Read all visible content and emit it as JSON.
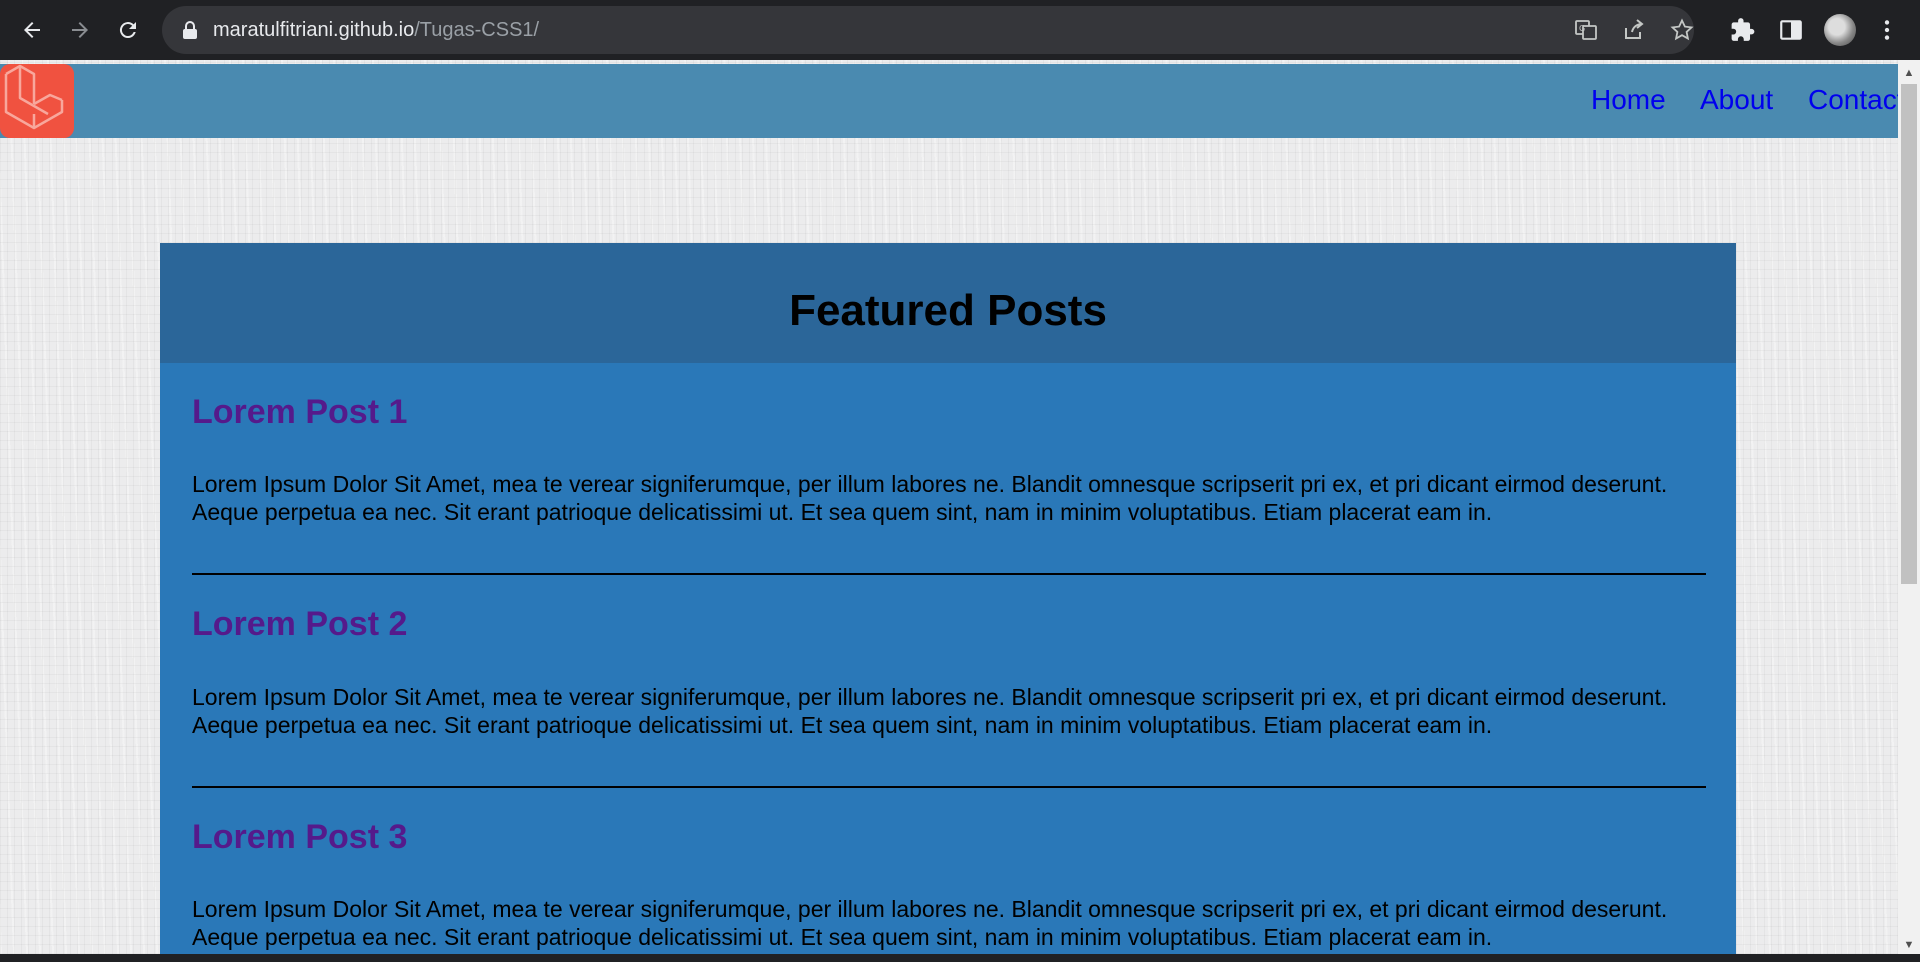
{
  "browser": {
    "url_host": "maratulfitriani.github.io",
    "url_path": "/Tugas-CSS1/",
    "icons": [
      "back-arrow-icon",
      "forward-arrow-icon",
      "reload-icon",
      "lock-icon",
      "translate-icon",
      "share-icon",
      "star-icon",
      "extensions-icon",
      "side-panel-icon",
      "profile-avatar",
      "kebab-menu-icon"
    ]
  },
  "header": {
    "logo": "laravel-logo-icon",
    "nav": [
      "Home",
      "About",
      "Contact"
    ]
  },
  "main": {
    "title": "Featured Posts",
    "posts": [
      {
        "title": "Lorem Post 1",
        "body": "Lorem Ipsum Dolor Sit Amet, mea te verear signiferumque, per illum labores ne. Blandit omnesque scripserit pri ex, et pri dicant eirmod deserunt. Aeque perpetua ea nec. Sit erant patrioque delicatissimi ut. Et sea quem sint, nam in minim voluptatibus. Etiam placerat eam in."
      },
      {
        "title": "Lorem Post 2",
        "body": "Lorem Ipsum Dolor Sit Amet, mea te verear signiferumque, per illum labores ne. Blandit omnesque scripserit pri ex, et pri dicant eirmod deserunt. Aeque perpetua ea nec. Sit erant patrioque delicatissimi ut. Et sea quem sint, nam in minim voluptatibus. Etiam placerat eam in."
      },
      {
        "title": "Lorem Post 3",
        "body": "Lorem Ipsum Dolor Sit Amet, mea te verear signiferumque, per illum labores ne. Blandit omnesque scripserit pri ex, et pri dicant eirmod deserunt. Aeque perpetua ea nec. Sit erant patrioque delicatissimi ut. Et sea quem sint, nam in minim voluptatibus. Etiam placerat eam in."
      }
    ]
  },
  "colors": {
    "header_bg": "#4a8ab0",
    "panel_bg": "#2a78b8",
    "panel_head_bg": "#2b6699",
    "link": "#0000ee",
    "visited_link": "#551a8b",
    "logo_bg": "#f05240"
  }
}
